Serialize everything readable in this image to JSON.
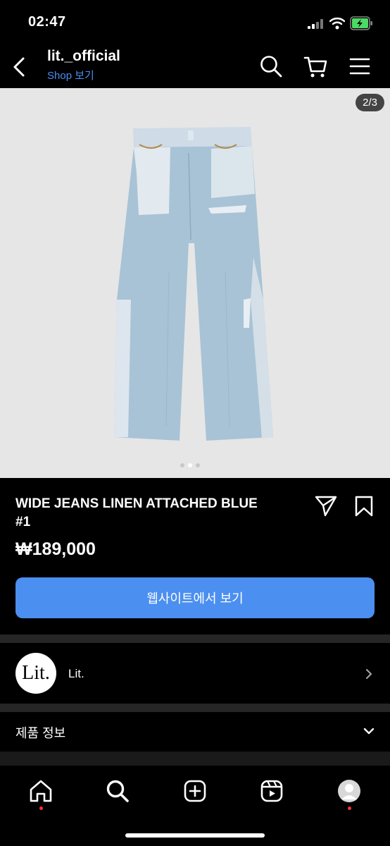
{
  "status_bar": {
    "time": "02:47"
  },
  "header": {
    "account_name": "lit._official",
    "shop_link": "Shop 보기"
  },
  "gallery": {
    "counter": "2/3",
    "dots": 3,
    "active_dot": 2
  },
  "product": {
    "title": "WIDE JEANS LINEN ATTACHED BLUE #1",
    "price": "₩189,000",
    "cta_label": "웹사이트에서 보기"
  },
  "brand": {
    "logo_text": "Lit.",
    "name": "Lit."
  },
  "product_info": {
    "label": "제품 정보"
  },
  "icons": {
    "back": "back-chevron-icon",
    "search": "search-icon",
    "cart": "cart-icon",
    "menu": "menu-icon",
    "share": "send-icon",
    "save": "bookmark-icon",
    "home": "home-icon",
    "explore": "search-icon",
    "create": "plus-square-icon",
    "reels": "reels-icon",
    "profile": "avatar-icon"
  },
  "colors": {
    "accent": "#4b8ff0",
    "link": "#4a8ff2",
    "background": "#000000",
    "notification": "#ff3333"
  }
}
